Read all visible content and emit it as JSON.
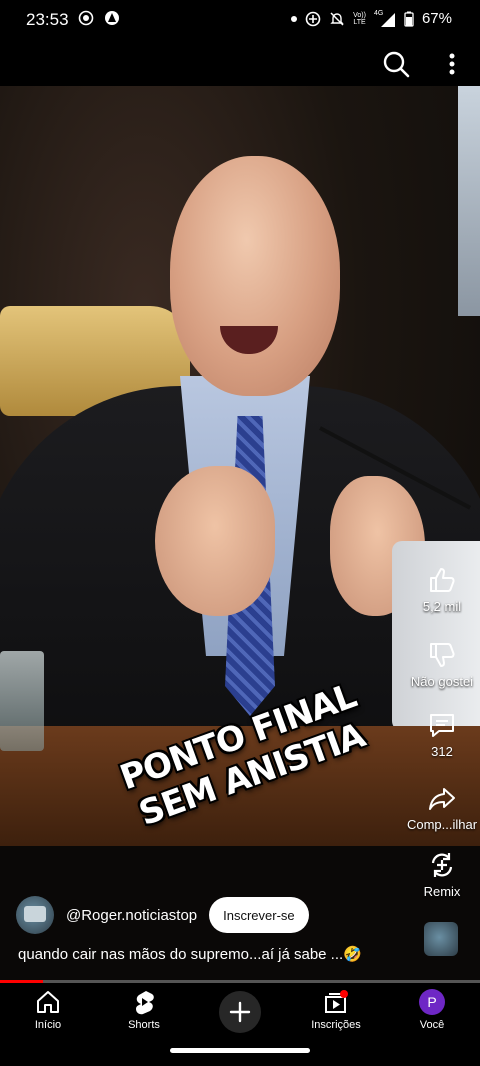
{
  "status_bar": {
    "time": "23:53",
    "network_top": "Vo))",
    "network_bottom": "LTE",
    "signal_type": "4G",
    "battery": "67%"
  },
  "top_bar": {
    "search_icon": "search-icon",
    "menu_icon": "more-vert-icon"
  },
  "video": {
    "overlay_lines": [
      "PONTO FINAL",
      "SEM ANISTIA"
    ]
  },
  "actions": {
    "like_count": "5,2 mil",
    "dislike_label": "Não gostei",
    "comment_count": "312",
    "share_label": "Comp...ilhar",
    "remix_label": "Remix"
  },
  "channel": {
    "name": "@Roger.noticiastop",
    "subscribe_label": "Inscrever-se"
  },
  "description": "quando cair nas mãos do supremo...aí já sabe ...🤣",
  "progress": {
    "fraction": 0.09
  },
  "bottom_nav": {
    "home": "Início",
    "shorts": "Shorts",
    "subscriptions": "Inscrições",
    "you": "Você",
    "profile_initial": "P"
  },
  "colors": {
    "accent_red": "#ff0000",
    "profile_purple": "#6e27c5"
  }
}
